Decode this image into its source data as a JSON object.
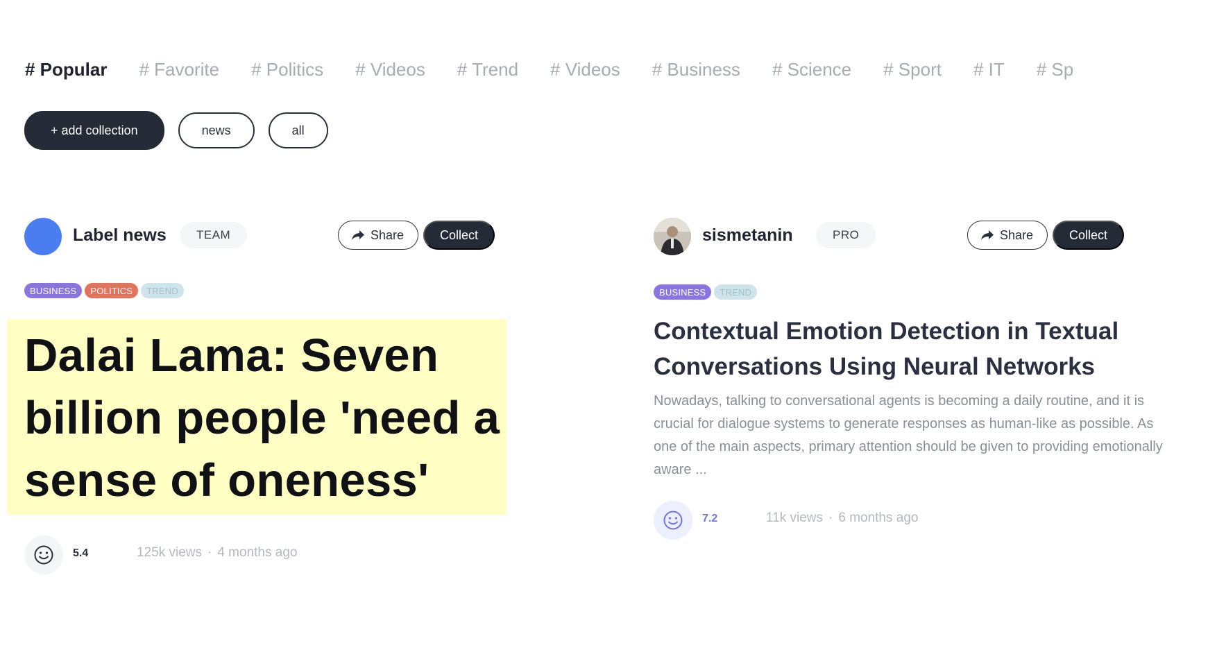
{
  "tags": [
    "# Popular",
    "# Favorite",
    "# Politics",
    "# Videos",
    "# Trend",
    "# Videos",
    "# Business",
    "# Science",
    "# Sport",
    "# IT",
    "# Sp"
  ],
  "collections": {
    "add_label": "+ add collection",
    "chips": [
      "news",
      "all"
    ]
  },
  "cards": [
    {
      "author": "Label news",
      "role": "TEAM",
      "share_label": "Share",
      "collect_label": "Collect",
      "categories": [
        "BUSINESS",
        "POLITICS",
        "TREND"
      ],
      "headline": "Dalai Lama: Seven billion people 'need a sense of oneness'",
      "score": "5.4",
      "views": "125k views",
      "age": "4 months ago",
      "avatar_color": "#4a7ef0"
    },
    {
      "author": "sismetanin",
      "role": "PRO",
      "share_label": "Share",
      "collect_label": "Collect",
      "categories": [
        "BUSINESS",
        "TREND"
      ],
      "headline": "Contextual Emotion Detection in Textual Conversations Using Neural Networks",
      "excerpt": "Nowadays, talking to conversational agents is becoming a daily routine, and it is crucial for dialogue systems to generate responses as human-like as possible. As one of the main aspects, primary attention should be given to providing emotionally aware ...",
      "score": "7.2",
      "views": "11k views",
      "age": "6 months ago",
      "score_color": "#6f74e0"
    }
  ],
  "colors": {
    "dark": "#252a37",
    "muted": "#a7abb3",
    "highlight": "#ffffc4"
  }
}
